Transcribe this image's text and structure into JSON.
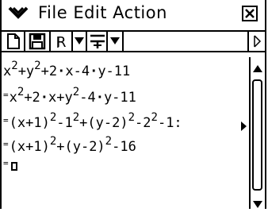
{
  "menubar": {
    "menu_text": "File Edit Action",
    "menu_items": [
      "File",
      "Edit",
      "Action"
    ]
  },
  "toolbar": {
    "buttons": [
      "new-document",
      "save",
      "R",
      "dropdown",
      "fraction-input",
      "dropdown",
      "scroll-right"
    ]
  },
  "editor": {
    "lines": [
      {
        "prefix": "",
        "parts": [
          "x",
          "2",
          "+y",
          "2",
          "+2",
          "·",
          "x-4",
          "·",
          "y-11"
        ]
      },
      {
        "prefix": "=",
        "parts": [
          "x",
          "2",
          "+2",
          "·",
          "x+y",
          "2",
          "-4",
          "·",
          "y-11"
        ]
      },
      {
        "prefix": "=",
        "parts": [
          "(x+1)",
          "2",
          "-1",
          "2",
          "+(y-2)",
          "2",
          "-2",
          "2",
          "-1:"
        ]
      },
      {
        "prefix": "=",
        "parts": [
          "(x+1)",
          "2",
          "+(y-2)",
          "2",
          "-16"
        ]
      },
      {
        "prefix": "=",
        "parts": []
      }
    ]
  }
}
